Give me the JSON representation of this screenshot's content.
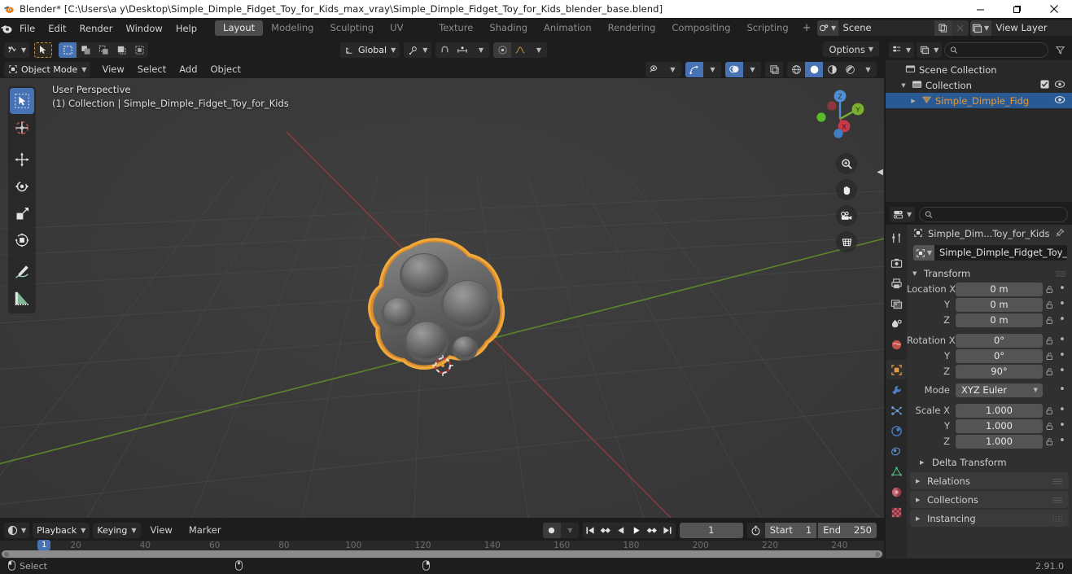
{
  "window": {
    "title": "Blender* [C:\\Users\\a y\\Desktop\\Simple_Dimple_Fidget_Toy_for_Kids_max_vray\\Simple_Dimple_Fidget_Toy_for_Kids_blender_base.blend]",
    "app_icon": "blender-logo-icon",
    "minimize": "minimize-icon",
    "maximize": "maximize-icon",
    "close": "close-icon"
  },
  "topbar": {
    "menus": [
      "File",
      "Edit",
      "Render",
      "Window",
      "Help"
    ],
    "workspace_tabs": [
      {
        "label": "Layout",
        "active": true
      },
      {
        "label": "Modeling",
        "active": false
      },
      {
        "label": "Sculpting",
        "active": false
      },
      {
        "label": "UV Editing",
        "active": false
      },
      {
        "label": "Texture Paint",
        "active": false
      },
      {
        "label": "Shading",
        "active": false
      },
      {
        "label": "Animation",
        "active": false
      },
      {
        "label": "Rendering",
        "active": false
      },
      {
        "label": "Compositing",
        "active": false
      },
      {
        "label": "Scripting",
        "active": false
      }
    ],
    "add_workspace": "+",
    "scene_name": "Scene",
    "view_layer_name": "View Layer"
  },
  "viewport": {
    "header": {
      "editor_type": "editor-type-3d-viewport",
      "mode": "Object Mode",
      "menus": [
        "View",
        "Select",
        "Add",
        "Object"
      ],
      "orientation": "Global",
      "options_label": "Options"
    },
    "overlay": {
      "perspective": "User Perspective",
      "scene_info": "(1) Collection | Simple_Dimple_Fidget_Toy_for_Kids"
    },
    "toolbar_tools": [
      {
        "name": "tweak-select-box",
        "active": true
      },
      {
        "name": "cursor",
        "active": false
      },
      {
        "name": "move",
        "active": false
      },
      {
        "name": "rotate",
        "active": false
      },
      {
        "name": "scale",
        "active": false
      },
      {
        "name": "transform",
        "active": false
      },
      {
        "name": "annotate",
        "active": false
      },
      {
        "name": "measure",
        "active": false
      }
    ],
    "gizmo_axes": [
      "X",
      "Y",
      "Z"
    ],
    "nav_buttons": [
      "zoom-icon",
      "pan-hand-icon",
      "camera-view-icon",
      "toggle-perspective-ortho-icon"
    ],
    "object_selection_color": "#e79a3a"
  },
  "outliner": {
    "search_placeholder": "",
    "rows": [
      {
        "label": "Scene Collection",
        "icon": "scene-collection-icon",
        "indent": 0,
        "selected": false,
        "has_tri": false,
        "checkbox": false,
        "eye": false
      },
      {
        "label": "Collection",
        "icon": "collection-icon",
        "indent": 1,
        "selected": false,
        "has_tri": true,
        "checkbox": true,
        "eye": true
      },
      {
        "label": "Simple_Dimple_Fidg",
        "icon": "mesh-object-icon",
        "indent": 2,
        "selected": true,
        "has_tri": true,
        "checkbox": false,
        "eye": true
      }
    ]
  },
  "properties": {
    "search_placeholder": "",
    "tabs": [
      {
        "name": "tool-tab",
        "active": false
      },
      {
        "name": "render-tab",
        "active": false
      },
      {
        "name": "output-tab",
        "active": false
      },
      {
        "name": "view-layer-tab",
        "active": false
      },
      {
        "name": "scene-tab",
        "active": false
      },
      {
        "name": "world-tab",
        "active": false
      },
      {
        "name": "object-tab",
        "active": true
      },
      {
        "name": "modifier-tab",
        "active": false
      },
      {
        "name": "particles-tab",
        "active": false
      },
      {
        "name": "physics-tab",
        "active": false
      },
      {
        "name": "constraints-tab",
        "active": false
      },
      {
        "name": "object-data-tab",
        "active": false
      },
      {
        "name": "material-tab",
        "active": false
      },
      {
        "name": "texture-tab",
        "active": false
      }
    ],
    "breadcrumb": "Simple_Dim...Toy_for_Kids",
    "object_name": "Simple_Dimple_Fidget_Toy_...",
    "transform_panel": "Transform",
    "fields": [
      {
        "label": "Location X",
        "value": "0 m"
      },
      {
        "label": "Y",
        "value": "0 m"
      },
      {
        "label": "Z",
        "value": "0 m"
      },
      {
        "label": "Rotation X",
        "value": "0°"
      },
      {
        "label": "Y",
        "value": "0°"
      },
      {
        "label": "Z",
        "value": "90°"
      }
    ],
    "mode_label": "Mode",
    "mode_value": "XYZ Euler",
    "scale_fields": [
      {
        "label": "Scale X",
        "value": "1.000"
      },
      {
        "label": "Y",
        "value": "1.000"
      },
      {
        "label": "Z",
        "value": "1.000"
      }
    ],
    "sub_panels": [
      "Delta Transform"
    ],
    "panels": [
      "Relations",
      "Collections",
      "Instancing"
    ]
  },
  "timeline": {
    "menus": [
      "Playback",
      "Keying",
      "View",
      "Marker"
    ],
    "current_frame": "1",
    "start_label": "Start",
    "start_value": "1",
    "end_label": "End",
    "end_value": "250",
    "ticks": [
      20,
      40,
      60,
      80,
      100,
      120,
      140,
      160,
      180,
      200,
      220,
      240
    ],
    "playhead_frame": "1",
    "playhead_label": "1"
  },
  "statusbar": {
    "select_label": "Select",
    "version": "2.91.0"
  }
}
